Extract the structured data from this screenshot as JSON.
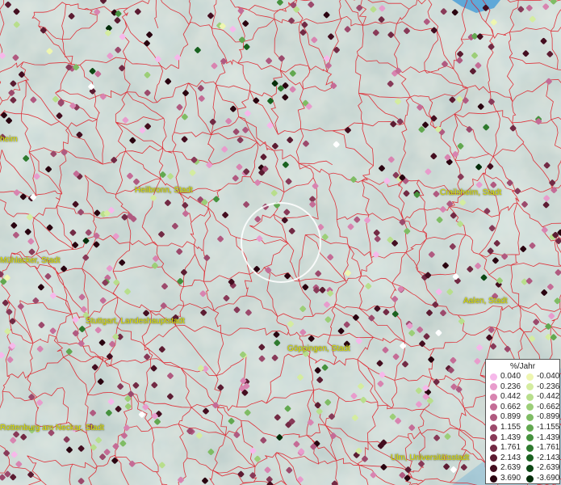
{
  "cities": [
    {
      "id": "heilbronn",
      "label": "Heilbronn, Stadt"
    },
    {
      "id": "crailsheim",
      "label": "Crailsheim, Stadt"
    },
    {
      "id": "muehlacker",
      "label": "Mühlacker, Stadt"
    },
    {
      "id": "aalen",
      "label": "Aalen, Stadt"
    },
    {
      "id": "stuttgart",
      "label": "Stuttgart, Landeshauptstadt"
    },
    {
      "id": "goeppingen",
      "label": "Göppingen, Stadt"
    },
    {
      "id": "rottenburg",
      "label": "Rottenburg am Neckar, Stadt"
    },
    {
      "id": "ulm",
      "label": "Ulm, Universitätsstadt"
    },
    {
      "id": "heim-partial",
      "label": "heim"
    }
  ],
  "legend": {
    "title": "%/Jahr",
    "positive": [
      {
        "value": "0.040",
        "color": "#f6b8ea"
      },
      {
        "value": "0.236",
        "color": "#e89ccc"
      },
      {
        "value": "0.442",
        "color": "#d884b0"
      },
      {
        "value": "0.662",
        "color": "#c46c96"
      },
      {
        "value": "0.899",
        "color": "#b05a80"
      },
      {
        "value": "1.155",
        "color": "#9c4a6c"
      },
      {
        "value": "1.439",
        "color": "#883a58"
      },
      {
        "value": "1.761",
        "color": "#722a44"
      },
      {
        "value": "2.143",
        "color": "#5c1c32"
      },
      {
        "value": "2.639",
        "color": "#440e20"
      },
      {
        "value": "3.690",
        "color": "#2a0410"
      }
    ],
    "negative": [
      {
        "value": "-0.040",
        "color": "#eef6b0"
      },
      {
        "value": "-0.236",
        "color": "#d4eca0"
      },
      {
        "value": "-0.442",
        "color": "#b8de8c"
      },
      {
        "value": "-0.662",
        "color": "#9cce78"
      },
      {
        "value": "-0.899",
        "color": "#7fbc64"
      },
      {
        "value": "-1.155",
        "color": "#62a850"
      },
      {
        "value": "-1.439",
        "color": "#46923e"
      },
      {
        "value": "-1.761",
        "color": "#2e7a2e"
      },
      {
        "value": "-2.143",
        "color": "#1a6220"
      },
      {
        "value": "-2.639",
        "color": "#0c4814"
      },
      {
        "value": "-3.690",
        "color": "#042e0a"
      }
    ]
  },
  "colors": {
    "boundary": "#e0141e",
    "label_text": "#e8e800",
    "water": "#5fa8d8"
  }
}
